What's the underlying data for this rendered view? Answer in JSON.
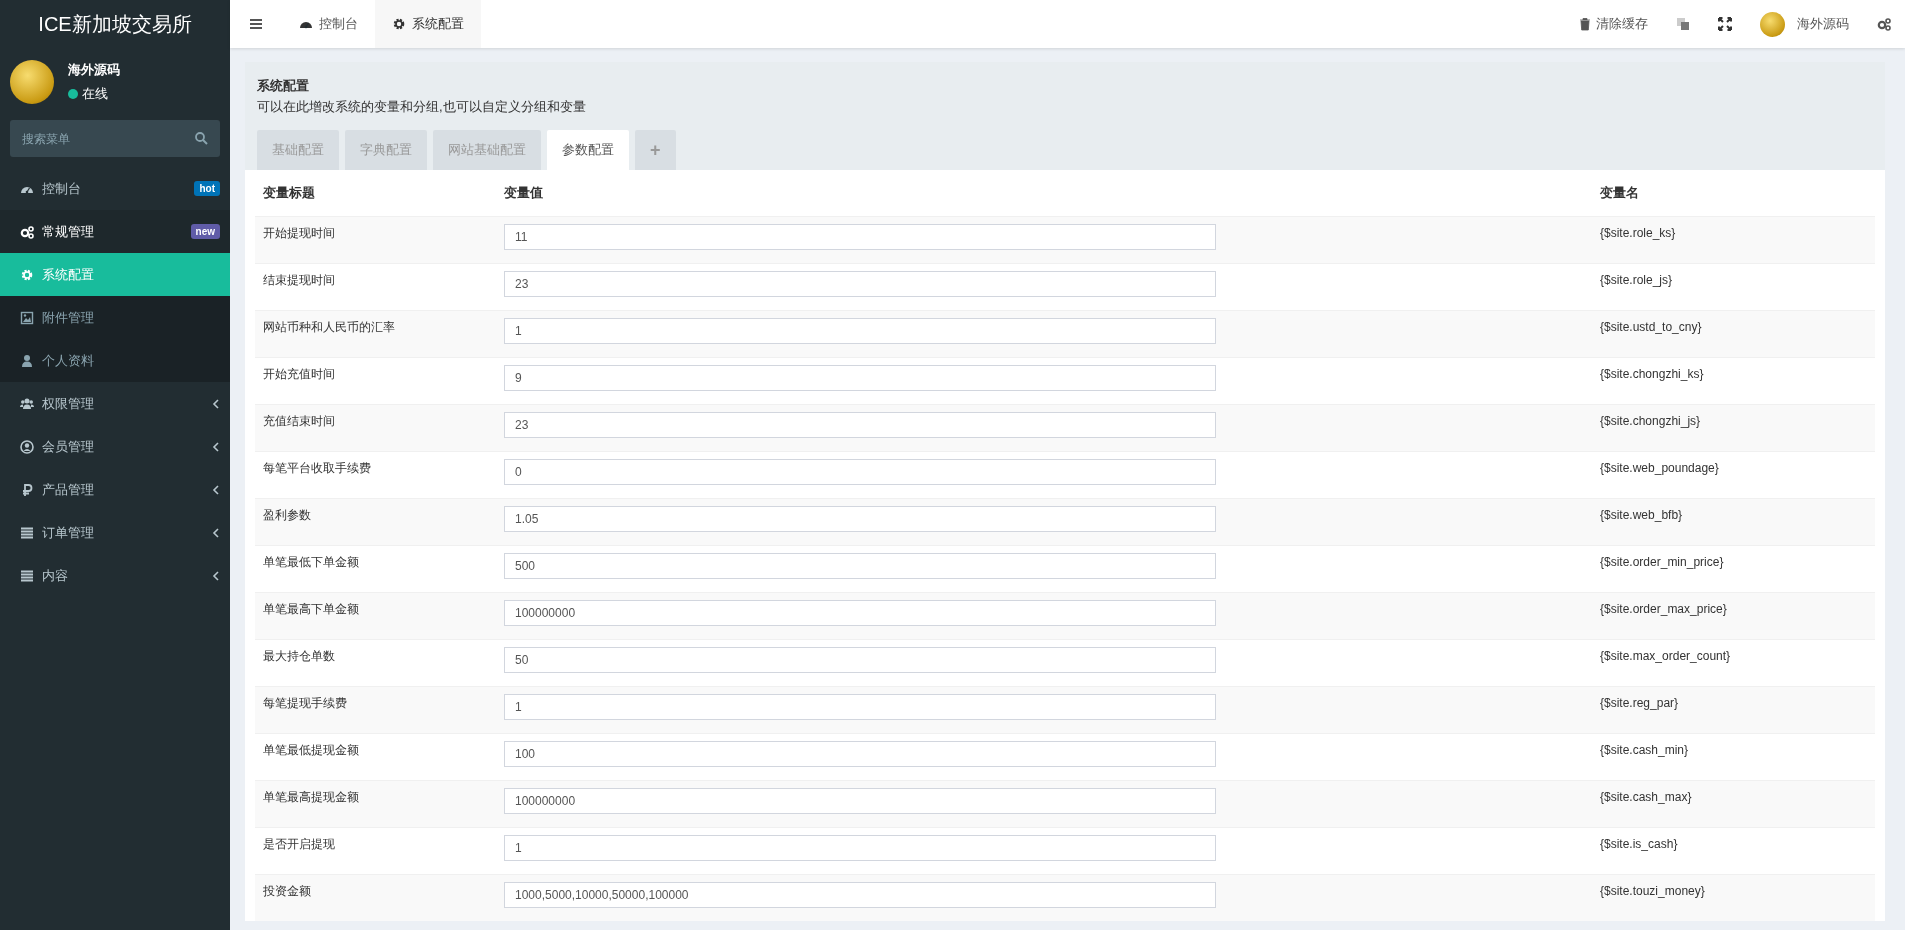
{
  "sidebar": {
    "logo": "ICE新加坡交易所",
    "user": {
      "name": "海外源码",
      "status": "在线",
      "online": true
    },
    "search": {
      "placeholder": "搜索菜单"
    },
    "items": [
      {
        "label": "控制台",
        "selected": false,
        "badge": {
          "text": "hot",
          "color": "#0073b7"
        }
      },
      {
        "label": "常规管理",
        "selected": false,
        "badge": {
          "text": "new",
          "color": "#605ca8"
        },
        "expanded": true,
        "children": [
          {
            "label": "系统配置",
            "selected": true
          },
          {
            "label": "附件管理",
            "selected": false
          },
          {
            "label": "个人资料",
            "selected": false
          }
        ]
      },
      {
        "label": "权限管理",
        "selected": false,
        "expanded": false
      },
      {
        "label": "会员管理",
        "selected": false,
        "expanded": false
      },
      {
        "label": "产品管理",
        "selected": false,
        "expanded": false
      },
      {
        "label": "订单管理",
        "selected": false,
        "expanded": false
      },
      {
        "label": "内容",
        "selected": false,
        "expanded": false
      }
    ]
  },
  "topbar": {
    "tabs": [
      {
        "label": "控制台",
        "selected": false
      },
      {
        "label": "系统配置",
        "selected": true
      }
    ],
    "clear_cache": "清除缓存",
    "user_name": "海外源码"
  },
  "panel": {
    "title": "系统配置",
    "description": "可以在此增改系统的变量和分组,也可以自定义分组和变量",
    "tabs": [
      {
        "label": "基础配置",
        "selected": false
      },
      {
        "label": "字典配置",
        "selected": false
      },
      {
        "label": "网站基础配置",
        "selected": false
      },
      {
        "label": "参数配置",
        "selected": true
      },
      {
        "label": "+",
        "selected": false
      }
    ],
    "table": {
      "columns": [
        "变量标题",
        "变量值",
        "变量名"
      ],
      "rows": [
        {
          "title": "开始提现时间",
          "value": "11",
          "name": "{$site.role_ks}"
        },
        {
          "title": "结束提现时间",
          "value": "23",
          "name": "{$site.role_js}"
        },
        {
          "title": "网站币种和人民币的汇率",
          "value": "1",
          "name": "{$site.ustd_to_cny}"
        },
        {
          "title": "开始充值时间",
          "value": "9",
          "name": "{$site.chongzhi_ks}"
        },
        {
          "title": "充值结束时间",
          "value": "23",
          "name": "{$site.chongzhi_js}"
        },
        {
          "title": "每笔平台收取手续费",
          "value": "0",
          "name": "{$site.web_poundage}"
        },
        {
          "title": "盈利参数",
          "value": "1.05",
          "name": "{$site.web_bfb}"
        },
        {
          "title": "单笔最低下单金额",
          "value": "500",
          "name": "{$site.order_min_price}"
        },
        {
          "title": "单笔最高下单金额",
          "value": "100000000",
          "name": "{$site.order_max_price}"
        },
        {
          "title": "最大持仓单数",
          "value": "50",
          "name": "{$site.max_order_count}"
        },
        {
          "title": "每笔提现手续费",
          "value": "1",
          "name": "{$site.reg_par}"
        },
        {
          "title": "单笔最低提现金额",
          "value": "100",
          "name": "{$site.cash_min}"
        },
        {
          "title": "单笔最高提现金额",
          "value": "100000000",
          "name": "{$site.cash_max}"
        },
        {
          "title": "是否开启提现",
          "value": "1",
          "name": "{$site.is_cash}"
        },
        {
          "title": "投资金额",
          "value": "1000,5000,10000,50000,100000",
          "name": "{$site.touzi_money}"
        }
      ]
    }
  }
}
